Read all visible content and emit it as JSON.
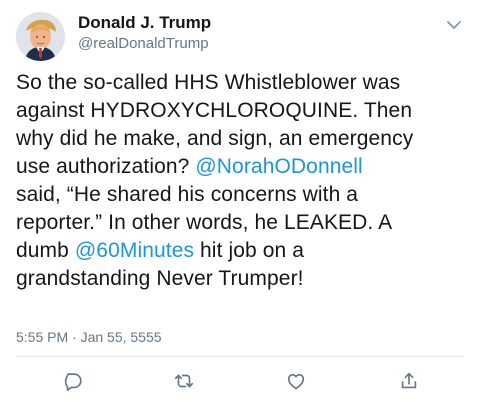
{
  "tweet": {
    "author": {
      "display_name": "Donald J. Trump",
      "handle": "@realDonaldTrump",
      "avatar_icon": "profile-photo"
    },
    "text_lines": [
      [
        {
          "text": "So the so-called HHS Whistleblower was",
          "type": "text"
        }
      ],
      [
        {
          "text": "against HYDROXYCHLOROQUINE. Then",
          "type": "text"
        }
      ],
      [
        {
          "text": "why did he make, and sign, an emergency",
          "type": "text"
        }
      ],
      [
        {
          "text": "use authorization? ",
          "type": "text"
        },
        {
          "text": "@NorahODonnell",
          "type": "mention"
        }
      ],
      [
        {
          "text": "said, “He shared his concerns with a",
          "type": "text"
        }
      ],
      [
        {
          "text": "reporter.” In other words, he LEAKED. A",
          "type": "text"
        }
      ],
      [
        {
          "text": "dumb ",
          "type": "text"
        },
        {
          "text": "@60Minutes",
          "type": "mention"
        },
        {
          "text": " hit job on a",
          "type": "text"
        }
      ],
      [
        {
          "text": "grandstanding Never Trumper!",
          "type": "text"
        }
      ]
    ],
    "timestamp": "5:55 PM · Jan 55, 5555",
    "actions": {
      "reply_icon": "reply-icon",
      "retweet_icon": "retweet-icon",
      "like_icon": "heart-icon",
      "share_icon": "share-icon",
      "menu_icon": "chevron-down-icon"
    },
    "colors": {
      "text": "#14171a",
      "secondary": "#657786",
      "link": "#1b95e0",
      "divider": "#e1e8ed"
    }
  }
}
